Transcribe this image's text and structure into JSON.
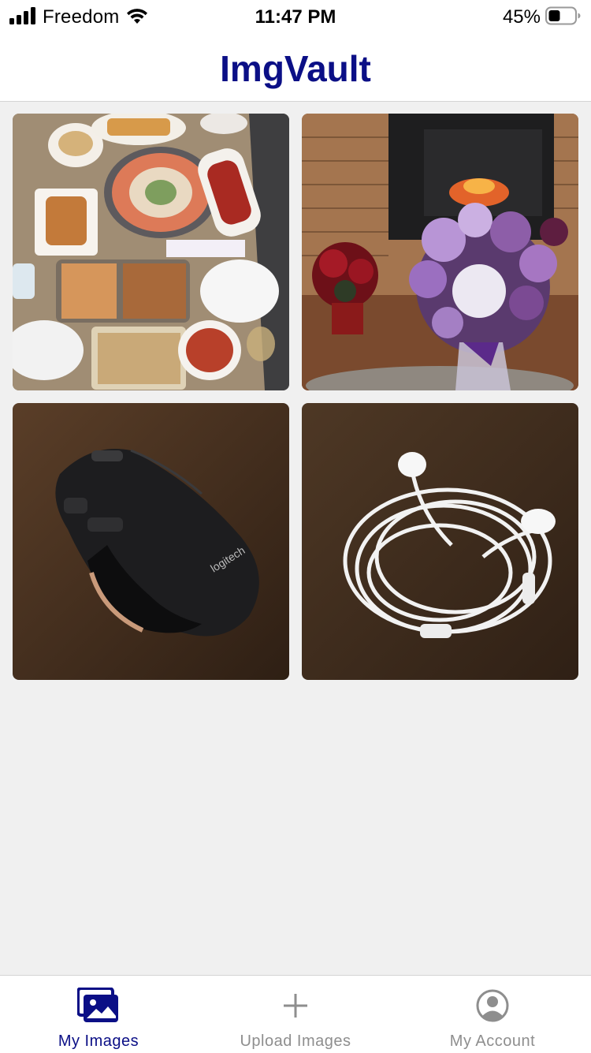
{
  "status_bar": {
    "carrier": "Freedom",
    "time": "11:47 PM",
    "battery_percent": "45%",
    "battery_level": 0.45,
    "signal_icon": "cellular-signal-icon",
    "wifi_icon": "wifi-icon",
    "battery_icon": "battery-icon"
  },
  "header": {
    "title": "ImgVault"
  },
  "images": [
    {
      "name": "food-platter-image",
      "alt": "Table of food platters"
    },
    {
      "name": "fireplace-flowers-image",
      "alt": "Flower bouquet in front of fireplace"
    },
    {
      "name": "logitech-mouse-image",
      "alt": "Logitech computer mouse",
      "brand_text": "logitech"
    },
    {
      "name": "earphones-image",
      "alt": "White wired earphones"
    }
  ],
  "tab_bar": {
    "active": "My Images",
    "tabs": [
      {
        "label": "My Images",
        "icon": "images-icon"
      },
      {
        "label": "Upload Images",
        "icon": "plus-icon"
      },
      {
        "label": "My Account",
        "icon": "account-icon"
      }
    ]
  },
  "colors": {
    "accent": "#0b0f86",
    "inactive": "#8e8e8e",
    "background": "#f0f0f0"
  }
}
